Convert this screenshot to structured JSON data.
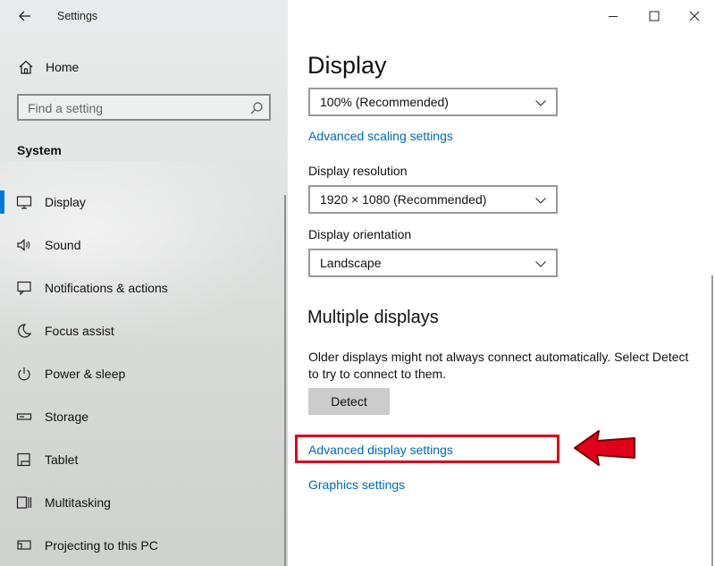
{
  "window": {
    "title": "Settings"
  },
  "sidebar": {
    "home_label": "Home",
    "search_placeholder": "Find a setting",
    "section_label": "System",
    "items": [
      {
        "label": "Display",
        "icon": "monitor-icon",
        "active": true
      },
      {
        "label": "Sound",
        "icon": "speaker-icon"
      },
      {
        "label": "Notifications & actions",
        "icon": "notification-icon"
      },
      {
        "label": "Focus assist",
        "icon": "moon-icon"
      },
      {
        "label": "Power & sleep",
        "icon": "power-icon"
      },
      {
        "label": "Storage",
        "icon": "storage-icon"
      },
      {
        "label": "Tablet",
        "icon": "tablet-icon"
      },
      {
        "label": "Multitasking",
        "icon": "multitasking-icon"
      },
      {
        "label": "Projecting to this PC",
        "icon": "projector-icon"
      }
    ]
  },
  "main": {
    "title": "Display",
    "scale_value": "100% (Recommended)",
    "advanced_scaling_link": "Advanced scaling settings",
    "resolution_label": "Display resolution",
    "resolution_value": "1920 × 1080 (Recommended)",
    "orientation_label": "Display orientation",
    "orientation_value": "Landscape",
    "multiple_displays_title": "Multiple displays",
    "multiple_displays_text": "Older displays might not always connect automatically. Select Detect to try to connect to them.",
    "detect_button": "Detect",
    "advanced_display_link": "Advanced display settings",
    "graphics_link": "Graphics settings"
  },
  "annotation": {
    "color": "#e0001b",
    "target": "advanced-display-settings-link"
  },
  "colors": {
    "accent": "#0078d7",
    "link": "#0067c0"
  }
}
